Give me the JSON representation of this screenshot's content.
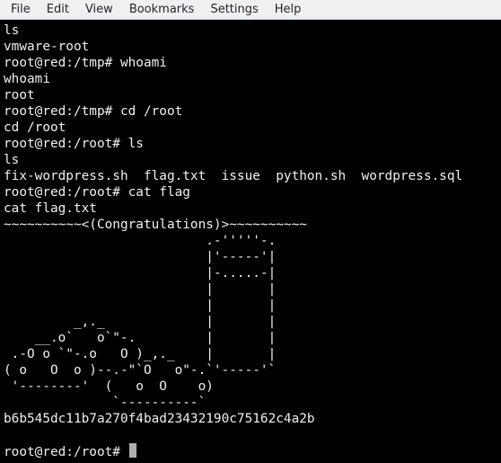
{
  "menu": {
    "items": [
      "File",
      "Edit",
      "View",
      "Bookmarks",
      "Settings",
      "Help"
    ]
  },
  "terminal": {
    "lines": [
      "ls",
      "vmware-root",
      "root@red:/tmp# whoami",
      "whoami",
      "root",
      "root@red:/tmp# cd /root",
      "cd /root",
      "root@red:/root# ls",
      "ls",
      "fix-wordpress.sh  flag.txt  issue  python.sh  wordpress.sql",
      "root@red:/root# cat flag",
      "cat flag.txt",
      "~~~~~~~~~~<(Congratulations)>~~~~~~~~~~",
      "                          .-'''''-.",
      "                          |'-----'|",
      "                          |-.....-|",
      "                          |       |",
      "                          |       |",
      "         _,._             |       |",
      "    __.o`   o`\"-.         |       |",
      " .-O o `\"-.o   O )_,._    |       |",
      "( o   O  o )--.-\"`O   o\"-.`'-----'`",
      " '--------'  (   o  O    o)",
      "              `----------`",
      "b6b545dc11b7a270f4bad23432190c75162c4a2b",
      ""
    ],
    "prompt": "root@red:/root# "
  },
  "colors": {
    "menubar_bg": "#eff0f1",
    "terminal_bg": "#000000",
    "terminal_fg": "#f0f0f0",
    "cursor": "#b0b0b0"
  }
}
